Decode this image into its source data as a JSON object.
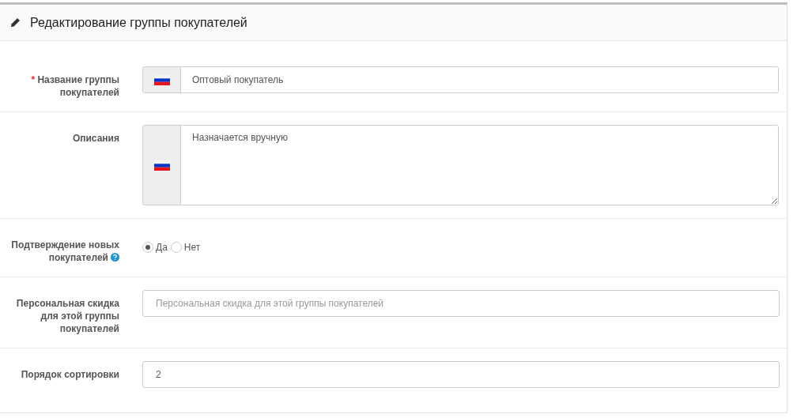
{
  "panel": {
    "title": "Редактирование группы покупателей"
  },
  "fields": [
    {
      "kind": "flag-input",
      "label": "Название группы покупателей",
      "required_mark": "*",
      "value": "Оптовый покупатель"
    },
    {
      "kind": "flag-textarea",
      "label": "Описания",
      "value": "Назначается вручную"
    },
    {
      "kind": "radio",
      "label": "Подтверждение новых покупателей",
      "help": true,
      "options": [
        {
          "label": "Да",
          "selected": true
        },
        {
          "label": "Нет",
          "selected": false
        }
      ]
    },
    {
      "kind": "input",
      "label": "Персональная скидка для этой группы покупателей",
      "placeholder": "Персональная скидка для этой группы покупателей"
    },
    {
      "kind": "input",
      "label": "Порядок сортировки",
      "value": "2"
    }
  ]
}
